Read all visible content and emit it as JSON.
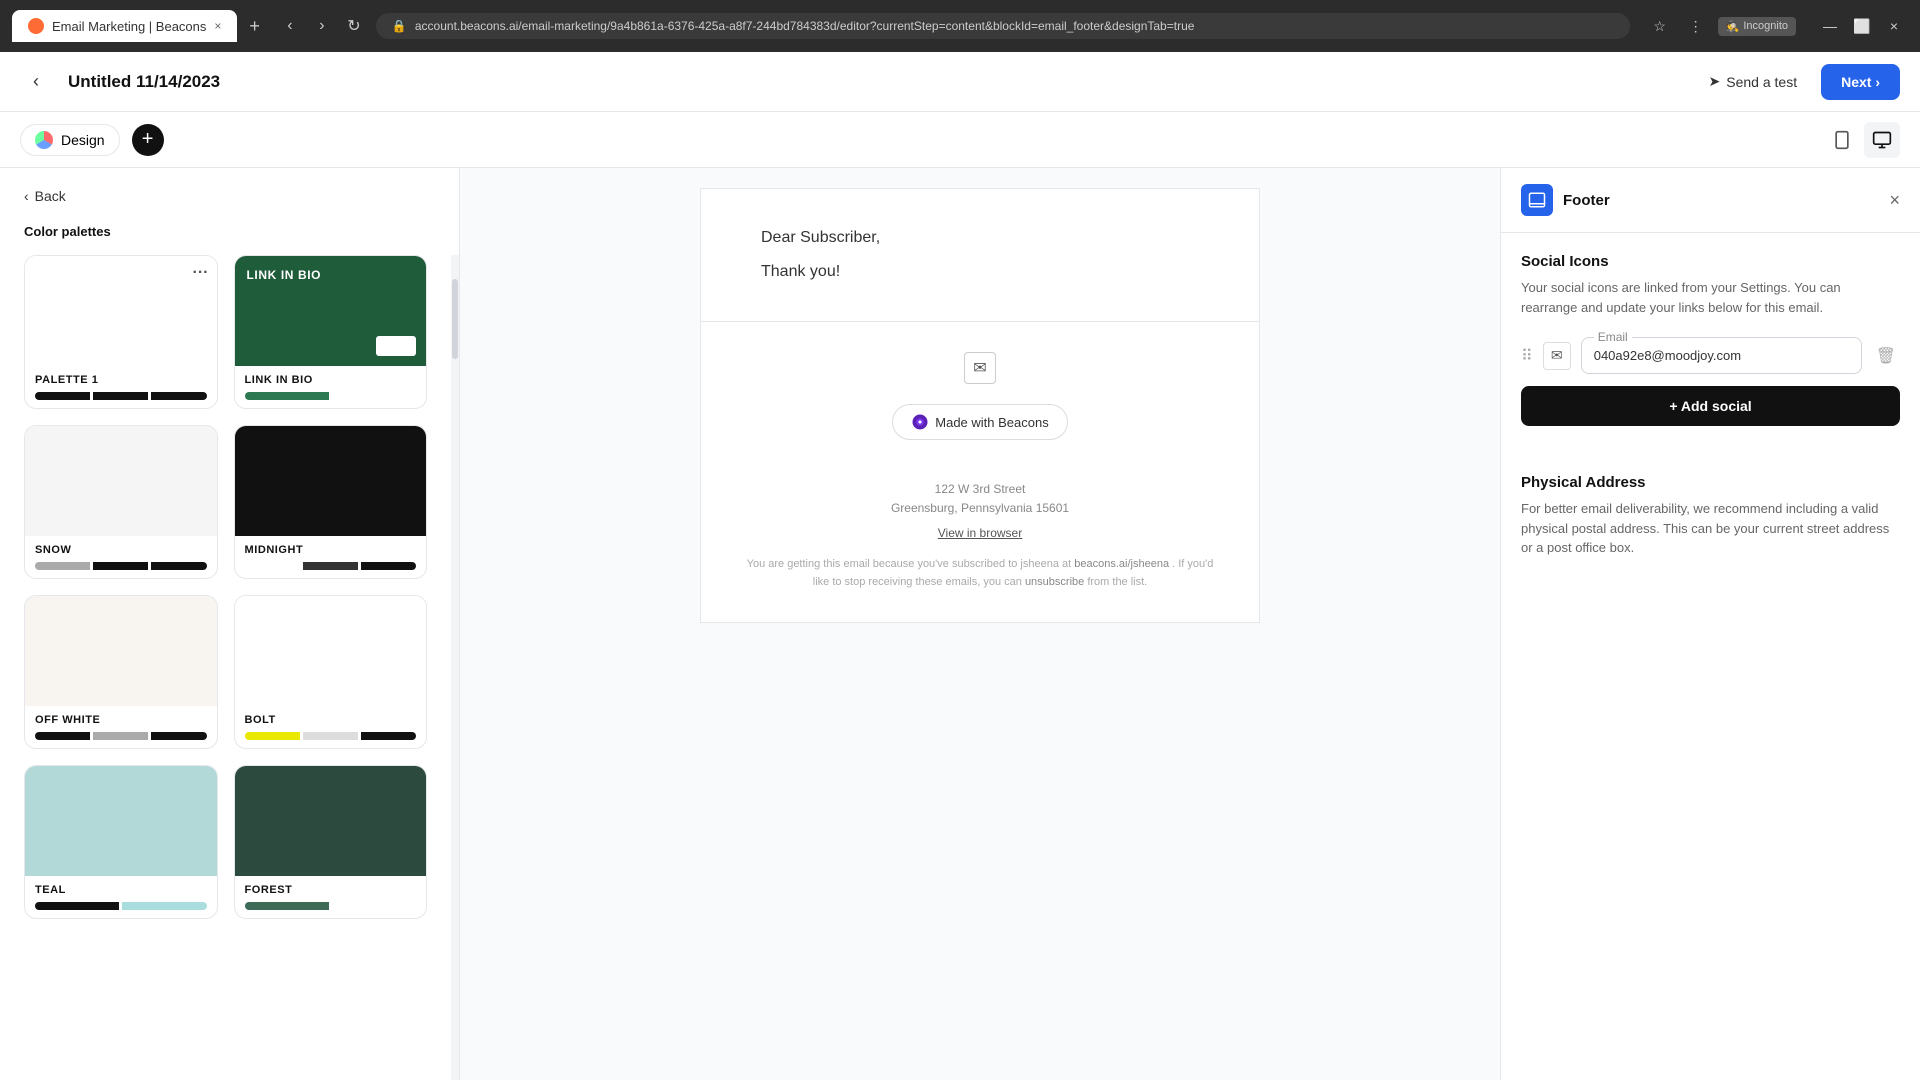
{
  "browser": {
    "tab_title": "Email Marketing | Beacons",
    "tab_close": "×",
    "new_tab": "+",
    "address": "account.beacons.ai/email-marketing/9a4b861a-6376-425a-a8f7-244bd784383d/editor?currentStep=content&blockId=email_footer&designTab=true",
    "incognito_label": "Incognito",
    "minimize": "—",
    "maximize": "⬜",
    "close": "×",
    "chevron_down": "⌄"
  },
  "app_header": {
    "back_label": "‹",
    "title": "Untitled 11/14/2023",
    "send_test_label": "Send a test",
    "next_label": "Next ›"
  },
  "toolbar": {
    "design_label": "Design",
    "add_icon": "+",
    "mobile_icon": "📱",
    "desktop_icon": "🖥"
  },
  "left_panel": {
    "back_label": "Back",
    "section_title": "Color palettes",
    "palettes": [
      {
        "id": "palette1",
        "name": "PALETTE 1",
        "bg": "#ffffff",
        "text_color": "#111",
        "has_menu": true,
        "colors": [
          "#111111",
          "#111111",
          "#111111"
        ]
      },
      {
        "id": "link-in-bio",
        "name": "LINK IN BIO",
        "bg": "#1e5c3a",
        "text_color": "#ffffff",
        "has_menu": false,
        "colors": [
          "#2d7a52",
          "#ffffff"
        ]
      },
      {
        "id": "snow",
        "name": "SNOW",
        "bg": "#f5f5f5",
        "text_color": "#111",
        "has_menu": false,
        "colors": [
          "#aaaaaa",
          "#111111",
          "#111111"
        ]
      },
      {
        "id": "midnight",
        "name": "MIDNIGHT",
        "bg": "#111111",
        "text_color": "#ffffff",
        "has_menu": false,
        "colors": [
          "#ffffff",
          "#333333",
          "#111111"
        ]
      },
      {
        "id": "off-white",
        "name": "OFF WHITE",
        "bg": "#f8f5f0",
        "text_color": "#111",
        "has_menu": false,
        "colors": [
          "#111111",
          "#aaaaaa",
          "#111111"
        ]
      },
      {
        "id": "bolt",
        "name": "BOLT",
        "bg": "#ffffff",
        "text_color": "#111",
        "has_menu": false,
        "colors": [
          "#e8e800",
          "#dddddd",
          "#111111"
        ]
      },
      {
        "id": "teal",
        "name": "TEAL",
        "bg": "#b2d8d8",
        "text_color": "#111",
        "has_menu": false,
        "colors": [
          "#111111",
          "#aadddd"
        ]
      },
      {
        "id": "forest",
        "name": "FOREST",
        "bg": "#2d4a3e",
        "text_color": "#ffffff",
        "has_menu": false,
        "colors": [
          "#3d6b58",
          "#ffffff"
        ]
      }
    ]
  },
  "email_preview": {
    "greeting": "Dear Subscriber,",
    "body": "Thank you!",
    "email_icon": "✉",
    "made_with_label": "Made with Beacons",
    "address_line1": "122 W 3rd Street",
    "address_line2": "Greensburg, Pennsylvania 15601",
    "view_in_browser": "View in browser",
    "unsub_text": "You are getting this email because you've subscribed to jsheena at",
    "unsub_link": "beacons.ai/jsheena",
    "unsub_suffix": ". If you'd like to stop receiving these emails, you can",
    "unsub_action": "unsubscribe",
    "unsub_end": "from the list."
  },
  "right_panel": {
    "close_icon": "×",
    "footer_label": "Footer",
    "footer_icon": "▣",
    "social_icons_section": {
      "title": "Social Icons",
      "description": "Your social icons are linked from your Settings. You can rearrange and update your links below for this email.",
      "social_items": [
        {
          "label": "Email",
          "value": "040a92e8@moodjoy.com",
          "icon": "✉"
        }
      ],
      "add_social_label": "+ Add social"
    },
    "physical_section": {
      "title": "Physical Address",
      "description": "For better email deliverability, we recommend including a valid physical postal address. This can be your current street address or a post office box."
    }
  }
}
